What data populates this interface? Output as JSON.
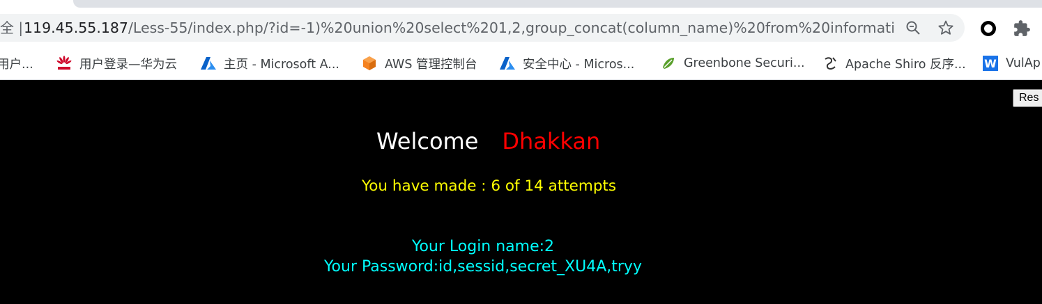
{
  "browser": {
    "security_label": "全 |",
    "url_host": "119.45.55.187",
    "url_rest": "/Less-55/index.php/?id=-1)%20union%20select%201,2,group_concat(column_name)%20from%20informati...",
    "icons": {
      "zoom": "zoom-icon",
      "bookmark_star": "star-icon",
      "extension_circle": "circle-extension-icon",
      "extensions": "puzzle-icon"
    }
  },
  "bookmarks": [
    {
      "label": "用户...",
      "icon": "none"
    },
    {
      "label": "用户登录—华为云",
      "icon": "huawei-icon"
    },
    {
      "label": "主页 - Microsoft A...",
      "icon": "azure-icon"
    },
    {
      "label": "AWS 管理控制台",
      "icon": "aws-icon"
    },
    {
      "label": "安全中心 - Micros...",
      "icon": "azure-icon"
    },
    {
      "label": "Greenbone Securi...",
      "icon": "greenbone-icon"
    },
    {
      "label": "Apache Shiro 反序...",
      "icon": "shiro-icon"
    },
    {
      "label": "VulAp",
      "icon": "w-icon"
    }
  ],
  "page": {
    "reset_label": "Res",
    "welcome_label": "Welcome",
    "welcome_name": "Dhakkan",
    "attempts_text": "You have made : 6 of 14 attempts",
    "login_name_text": "Your Login name:2",
    "password_text": "Your Password:id,sessid,secret_XU4A,tryy"
  },
  "colors": {
    "page_bg": "#000000",
    "welcome": "#ffffff",
    "name": "#ff0000",
    "attempts": "#ffff00",
    "result": "#00ffff"
  }
}
